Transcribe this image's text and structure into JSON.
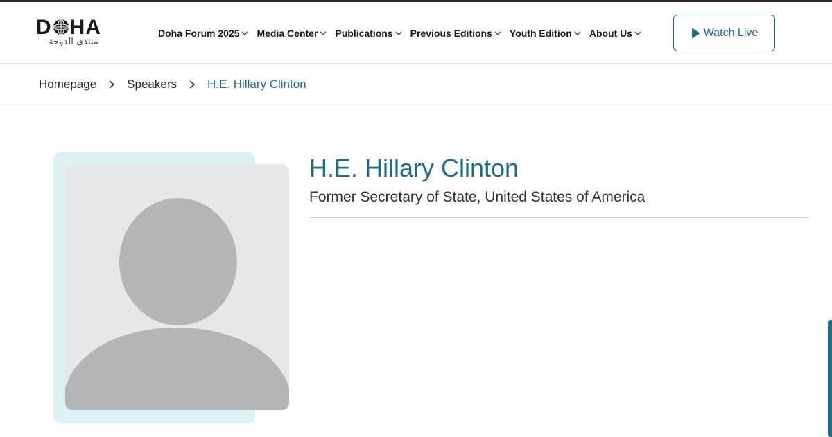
{
  "brand": {
    "logo_text": "DOHA",
    "logo_arabic": "منتدى الدوحة",
    "accent_color": "#1c6e86"
  },
  "nav": {
    "items": [
      {
        "label": "Doha Forum 2025"
      },
      {
        "label": "Media Center"
      },
      {
        "label": "Publications"
      },
      {
        "label": "Previous Editions"
      },
      {
        "label": "Youth Edition"
      },
      {
        "label": "About Us"
      }
    ]
  },
  "header": {
    "watch_live_label": "Watch Live"
  },
  "breadcrumb": {
    "items": [
      "Homepage",
      "Speakers",
      "H.E. Hillary Clinton"
    ]
  },
  "speaker": {
    "name": "H.E. Hillary Clinton",
    "title": "Former Secretary of State, United States of America",
    "photo_icon": "avatar-placeholder-icon"
  }
}
